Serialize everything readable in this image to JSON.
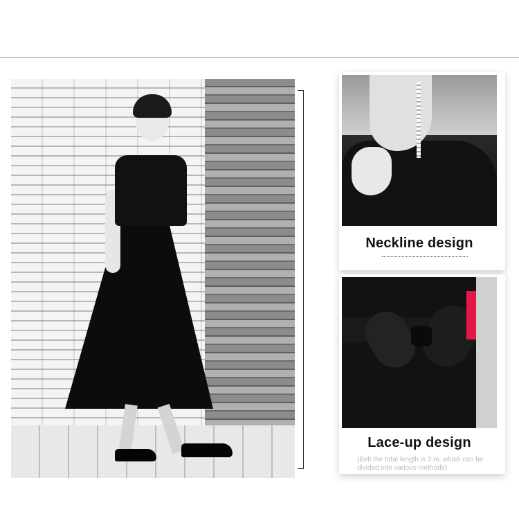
{
  "cards": [
    {
      "title": "Neckline design"
    },
    {
      "title": "Lace-up design",
      "note": "(Belt the total length is 3 m, which can be divided into various methods)"
    }
  ],
  "colors": {
    "accent": "#e21849",
    "text": "#111111",
    "note": "#bbbbbb"
  }
}
